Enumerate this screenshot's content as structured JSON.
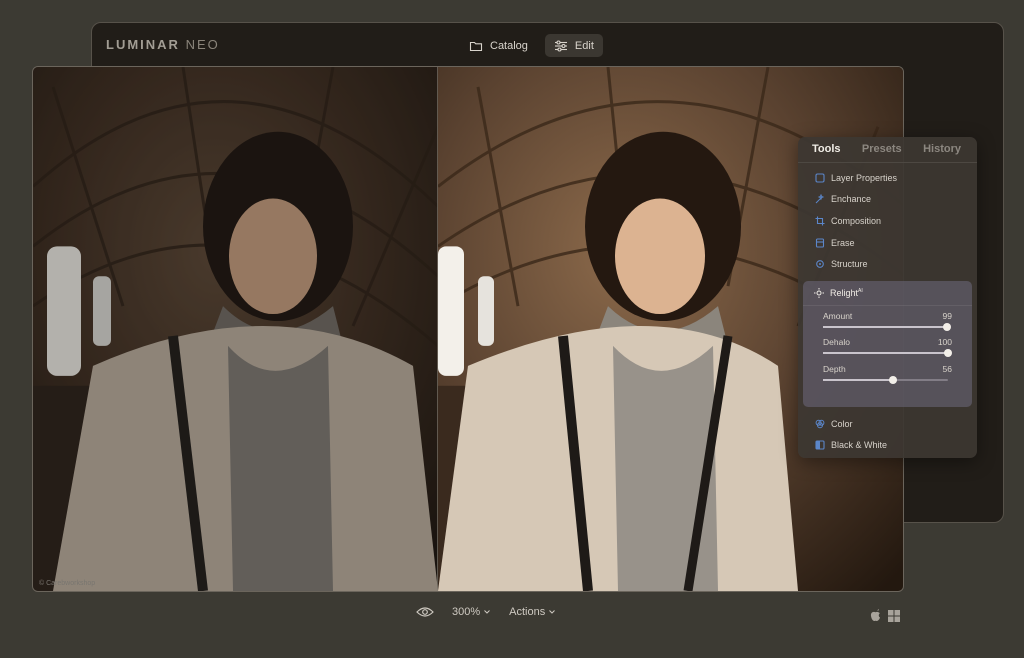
{
  "app": {
    "brand_main": "LUMINAR",
    "brand_accent": "NEO"
  },
  "top_tabs": [
    {
      "label": "Catalog",
      "icon": "folder-icon",
      "active": false
    },
    {
      "label": "Edit",
      "icon": "sliders-icon",
      "active": true
    }
  ],
  "canvas": {
    "watermark": "© Carebworkshop"
  },
  "panel": {
    "tabs": [
      "Tools",
      "Presets",
      "History"
    ],
    "tools_top": [
      {
        "label": "Layer Properties",
        "icon": "layer-properties-icon"
      },
      {
        "label": "Enchance",
        "icon": "enhance-icon"
      },
      {
        "label": "Composition",
        "icon": "composition-icon"
      },
      {
        "label": "Erase",
        "icon": "erase-icon"
      },
      {
        "label": "Structure",
        "icon": "structure-icon"
      }
    ],
    "relight": {
      "label": "Relight",
      "badge": "AI",
      "sliders": [
        {
          "label": "Amount",
          "value": 99
        },
        {
          "label": "Dehalo",
          "value": 100
        },
        {
          "label": "Depth",
          "value": 56
        }
      ]
    },
    "tools_bottom": [
      {
        "label": "Color",
        "icon": "color-icon"
      },
      {
        "label": "Black & White",
        "icon": "black-white-icon"
      }
    ]
  },
  "bottom_bar": {
    "zoom": "300%",
    "actions": "Actions"
  },
  "colors": {
    "accent": "#5b86c9",
    "panel_highlight": "#6e697d"
  }
}
